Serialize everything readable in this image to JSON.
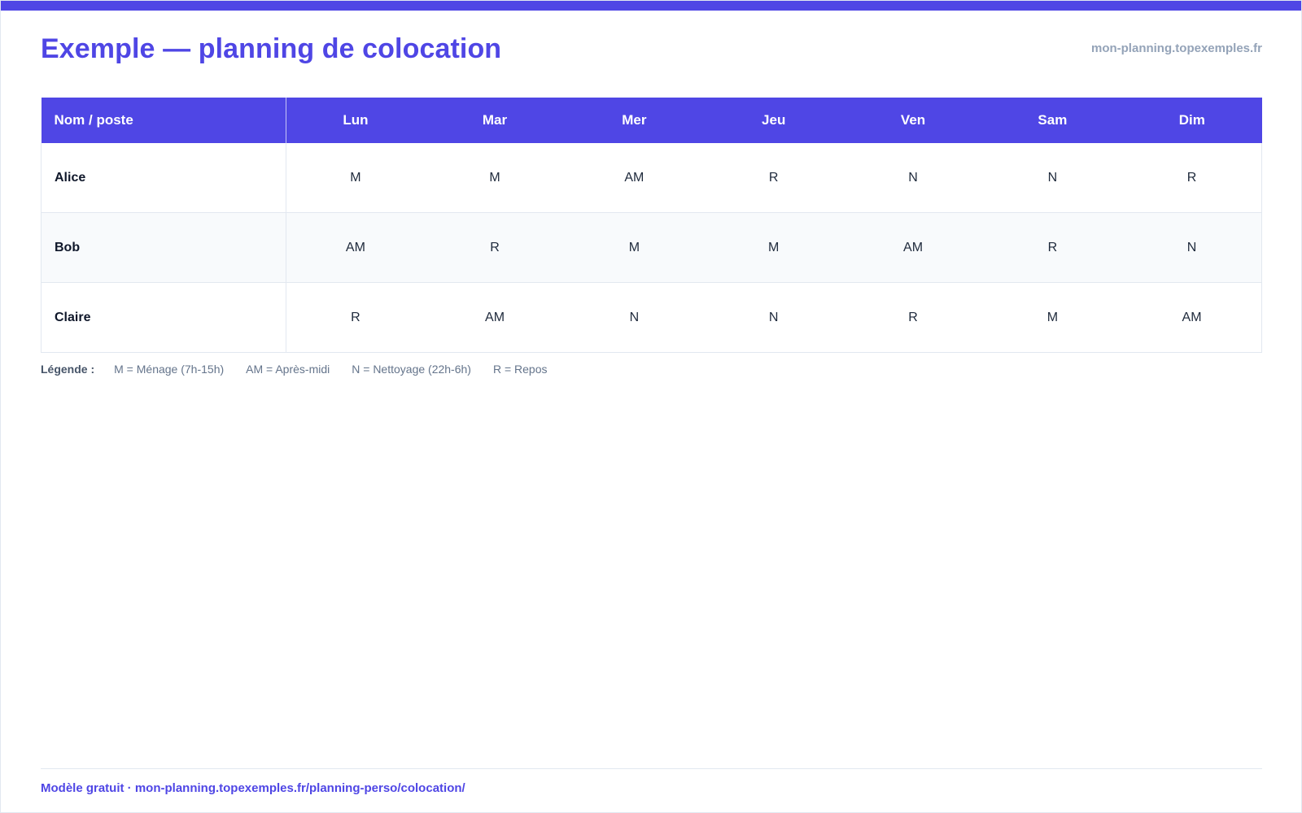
{
  "header": {
    "title": "Exemple — planning de colocation",
    "site": "mon-planning.topexemples.fr"
  },
  "table": {
    "columns": [
      "Nom / poste",
      "Lun",
      "Mar",
      "Mer",
      "Jeu",
      "Ven",
      "Sam",
      "Dim"
    ],
    "rows": [
      {
        "name": "Alice",
        "cells": [
          "M",
          "M",
          "AM",
          "R",
          "N",
          "N",
          "R"
        ]
      },
      {
        "name": "Bob",
        "cells": [
          "AM",
          "R",
          "M",
          "M",
          "AM",
          "R",
          "N"
        ]
      },
      {
        "name": "Claire",
        "cells": [
          "R",
          "AM",
          "N",
          "N",
          "R",
          "M",
          "AM"
        ]
      }
    ]
  },
  "legend": {
    "label": "Légende :",
    "items": [
      "M = Ménage (7h-15h)",
      "AM = Après-midi",
      "N = Nettoyage (22h-6h)",
      "R = Repos"
    ]
  },
  "footer": {
    "text": "Modèle gratuit · mon-planning.topexemples.fr/planning-perso/colocation/"
  },
  "colors": {
    "accent": "#4f46e5",
    "muted": "#94a3b8",
    "alt_row": "#f8fafc"
  }
}
